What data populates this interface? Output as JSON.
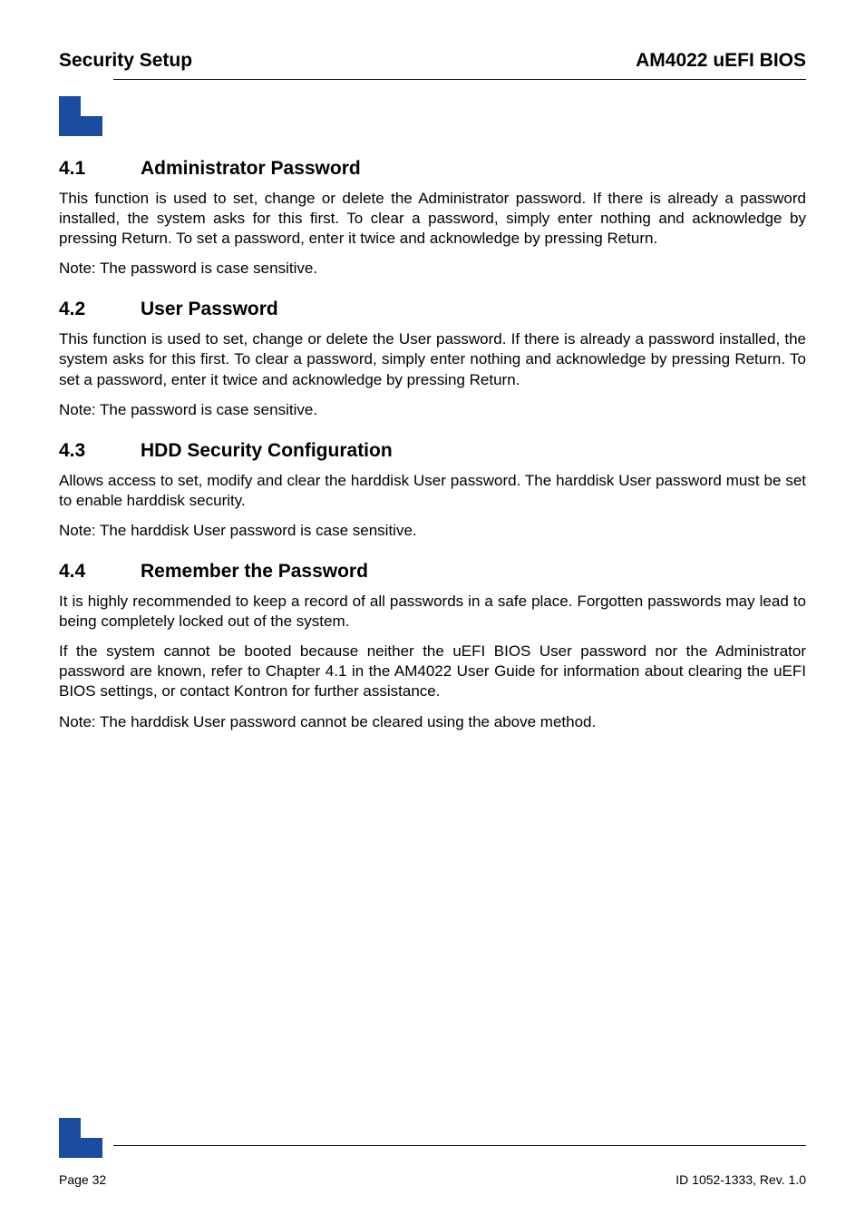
{
  "header": {
    "left": "Security Setup",
    "right": "AM4022 uEFI BIOS"
  },
  "sections": [
    {
      "num": "4.1",
      "title": "Administrator Password",
      "paragraphs": [
        "This function is used to set, change or delete the Administrator password. If there is already a password installed, the system asks for this first. To clear a password, simply enter nothing and acknowledge by pressing Return. To set a password, enter it twice and acknowledge by pressing Return.",
        "Note: The password is case sensitive."
      ]
    },
    {
      "num": "4.2",
      "title": "User Password",
      "paragraphs": [
        "This function is used to set, change or delete the User password. If there is already a password installed, the system asks for this first. To clear a password, simply enter nothing and acknowledge by pressing Return. To set a password, enter it twice and acknowledge by pressing Return.",
        "Note: The password is case sensitive."
      ]
    },
    {
      "num": "4.3",
      "title": "HDD Security Configuration",
      "paragraphs": [
        "Allows access to set, modify and clear the harddisk User password. The harddisk User password must be set to enable harddisk security.",
        "Note: The harddisk User password is case sensitive."
      ]
    },
    {
      "num": "4.4",
      "title": "Remember the Password",
      "paragraphs": [
        "It is highly recommended to keep a record of all passwords in a safe place. Forgotten passwords may lead to being completely locked out of the system.",
        "If the system cannot be booted because neither the uEFI BIOS User password nor the Administrator password are known, refer to Chapter 4.1 in the AM4022 User Guide for information about clearing the uEFI BIOS settings, or contact Kontron for further assistance.",
        "Note: The harddisk User password cannot be cleared using the above method."
      ]
    }
  ],
  "footer": {
    "page_label": "Page 32",
    "doc_id": "ID 1052-1333, Rev. 1.0"
  }
}
